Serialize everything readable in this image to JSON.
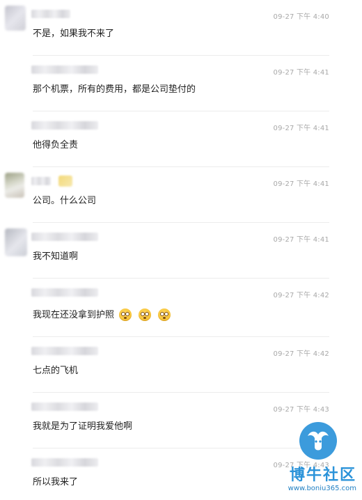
{
  "messages": [
    {
      "time": "09-27 下午 4:40",
      "text": "不是，如果我不来了"
    },
    {
      "time": "09-27 下午 4:41",
      "text": "那个机票，所有的费用，都是公司垫付的"
    },
    {
      "time": "09-27 下午 4:41",
      "text": "他得负全责"
    },
    {
      "time": "09-27 下午 4:41",
      "text": "公司。什么公司"
    },
    {
      "time": "09-27 下午 4:41",
      "text": "我不知道啊"
    },
    {
      "time": "09-27 下午 4:42",
      "text": "我现在还没拿到护照"
    },
    {
      "time": "09-27 下午 4:42",
      "text": "七点的飞机"
    },
    {
      "time": "09-27 下午 4:43",
      "text": "我就是为了证明我爱他啊"
    },
    {
      "time": "09-27 下午 4:43",
      "text": "所以我来了"
    }
  ],
  "emoji_icons": [
    "flushed-emoji",
    "flushed-emoji",
    "flushed-emoji"
  ],
  "watermark": {
    "title": "博牛社区",
    "url": "www.boniu365.com",
    "color": "#2b93d9"
  },
  "colors": {
    "timestamp": "#a8a8a8",
    "divider": "#ececec",
    "text": "#1f1f1f"
  }
}
